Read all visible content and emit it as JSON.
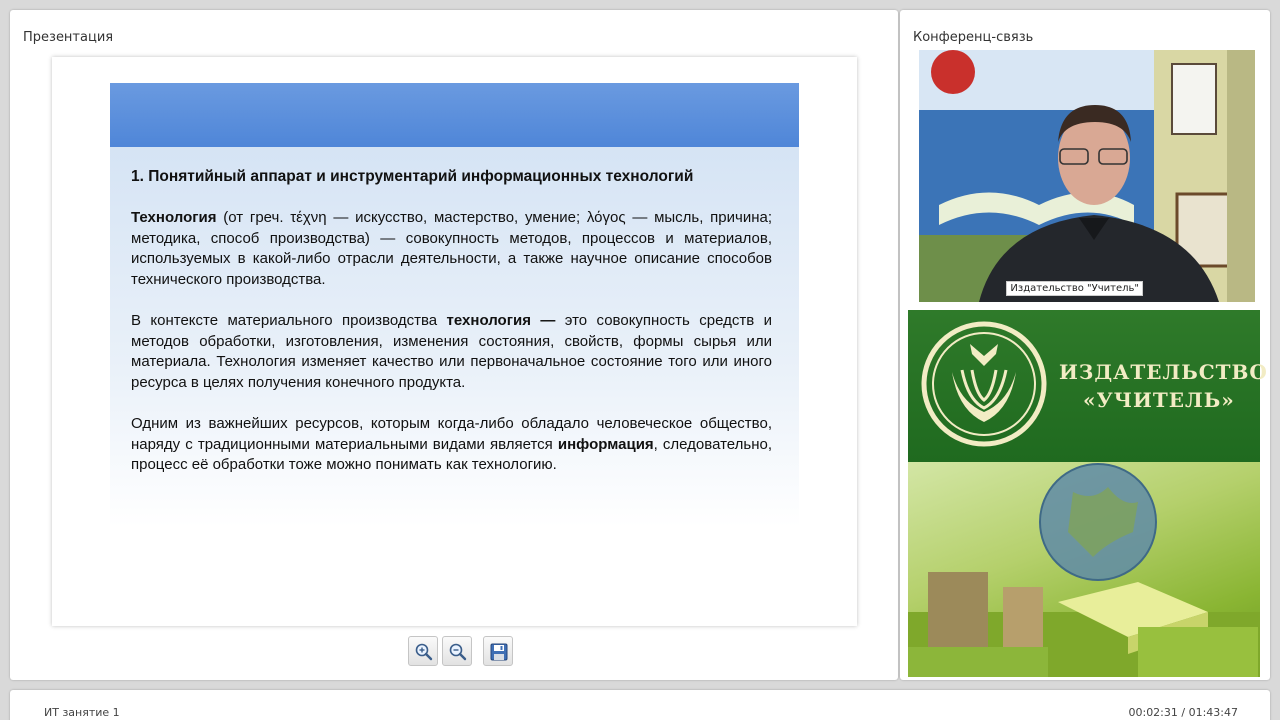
{
  "presentation": {
    "title": "Презентация",
    "slide": {
      "heading": "1. Понятийный аппарат и инструментарий информационных технологий",
      "p1_term": "Технология",
      "p1_text": " (от греч. τέχνη — искусство, мастерство, умение; λόγος — мысль, причина; методика, способ производства) — совокупность методов, процессов и материалов, используемых в какой-либо отрасли деятельности, а также научное описание способов технического производства.",
      "p2_lead": "В контексте материального производства ",
      "p2_term": "технология —",
      "p2_text": "  это совокупность средств и методов обработки, изготовления, изменения состояния, свойств, формы сырья или материала. Технология изменяет качество или первоначальное состояние того или иного ресурса в целях получения конечного продукта.",
      "p3_lead": "Одним из важнейших ресурсов, которым когда-либо обладало человеческое общество, наряду с традиционными материальными видами является ",
      "p3_term": "информация",
      "p3_text": ", следовательно, процесс её обработки тоже можно понимать как технологию."
    },
    "toolbar": {
      "zoom_in_icon": "zoom-in-icon",
      "zoom_out_icon": "zoom-out-icon",
      "save_icon": "save-icon"
    }
  },
  "conference": {
    "title": "Конференц-связь",
    "video_name_tag": "Издательство \"Учитель\"",
    "logo_line1": "ИЗДАТЕЛЬСТВО",
    "logo_line2": "«УЧИТЕЛЬ»"
  },
  "footer": {
    "course_title": "ИТ занятие 1",
    "timecode": "00:02:31 / 01:43:47"
  },
  "colors": {
    "slide_header": "#4f86d8",
    "logo_green": "#1f6a1f",
    "logo_text": "#f2ecc4"
  }
}
